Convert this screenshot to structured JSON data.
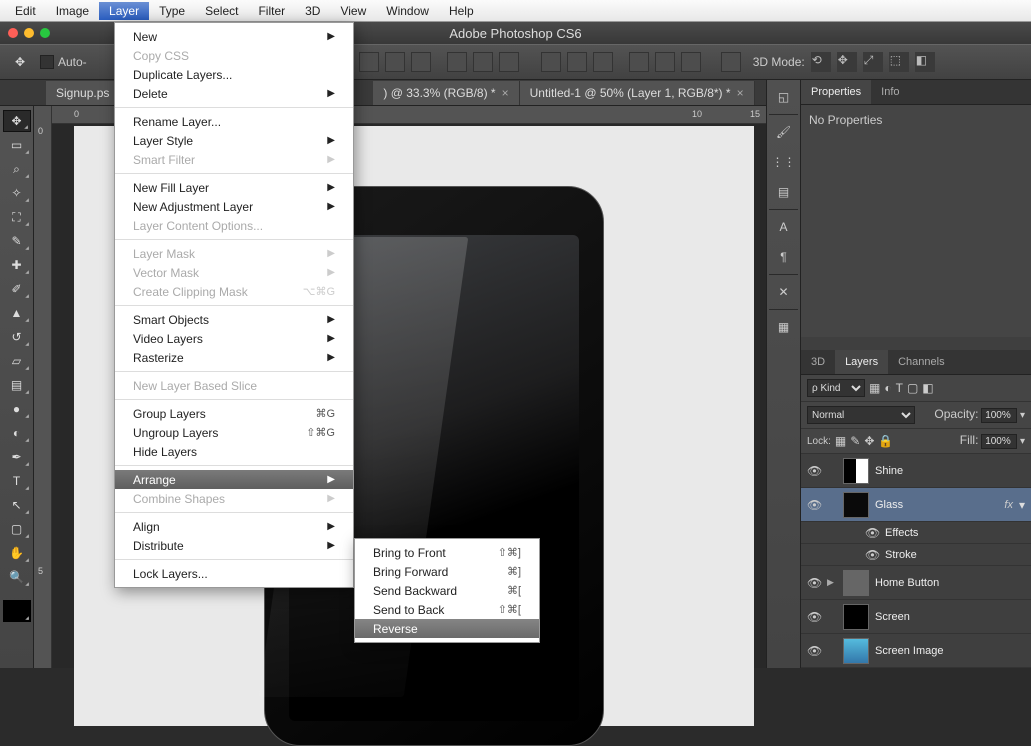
{
  "menubar": [
    "Edit",
    "Image",
    "Layer",
    "Type",
    "Select",
    "Filter",
    "3D",
    "View",
    "Window",
    "Help"
  ],
  "activeMenu": "Layer",
  "windowTitle": "Adobe Photoshop CS6",
  "optbar": {
    "auto": "Auto-",
    "mode3d": "3D Mode:"
  },
  "docTabs": [
    {
      "label": "Signup.ps",
      "close": "×"
    },
    {
      "label": ") @ 33.3% (RGB/8) *",
      "close": "×"
    },
    {
      "label": "Untitled-1 @ 50% (Layer 1, RGB/8*) *",
      "close": "×"
    }
  ],
  "rulerH": [
    "0",
    "10",
    "15"
  ],
  "rulerV": [
    "0",
    "5"
  ],
  "layerMenu": [
    {
      "t": "New",
      "arrow": true
    },
    {
      "t": "Copy CSS",
      "disabled": true
    },
    {
      "t": "Duplicate Layers..."
    },
    {
      "t": "Delete",
      "arrow": true
    },
    {
      "sep": true
    },
    {
      "t": "Rename Layer..."
    },
    {
      "t": "Layer Style",
      "arrow": true
    },
    {
      "t": "Smart Filter",
      "arrow": true,
      "disabled": true
    },
    {
      "sep": true
    },
    {
      "t": "New Fill Layer",
      "arrow": true
    },
    {
      "t": "New Adjustment Layer",
      "arrow": true
    },
    {
      "t": "Layer Content Options...",
      "disabled": true
    },
    {
      "sep": true
    },
    {
      "t": "Layer Mask",
      "arrow": true,
      "disabled": true
    },
    {
      "t": "Vector Mask",
      "arrow": true,
      "disabled": true
    },
    {
      "t": "Create Clipping Mask",
      "sc": "⌥⌘G",
      "disabled": true
    },
    {
      "sep": true
    },
    {
      "t": "Smart Objects",
      "arrow": true
    },
    {
      "t": "Video Layers",
      "arrow": true
    },
    {
      "t": "Rasterize",
      "arrow": true
    },
    {
      "sep": true
    },
    {
      "t": "New Layer Based Slice",
      "disabled": true
    },
    {
      "sep": true
    },
    {
      "t": "Group Layers",
      "sc": "⌘G"
    },
    {
      "t": "Ungroup Layers",
      "sc": "⇧⌘G"
    },
    {
      "t": "Hide Layers"
    },
    {
      "sep": true
    },
    {
      "t": "Arrange",
      "arrow": true,
      "hover": true
    },
    {
      "t": "Combine Shapes",
      "arrow": true,
      "disabled": true
    },
    {
      "sep": true
    },
    {
      "t": "Align",
      "arrow": true
    },
    {
      "t": "Distribute",
      "arrow": true
    },
    {
      "sep": true
    },
    {
      "t": "Lock Layers..."
    }
  ],
  "arrangeSub": [
    {
      "t": "Bring to Front",
      "sc": "⇧⌘]"
    },
    {
      "t": "Bring Forward",
      "sc": "⌘]"
    },
    {
      "t": "Send Backward",
      "sc": "⌘["
    },
    {
      "t": "Send to Back",
      "sc": "⇧⌘["
    },
    {
      "t": "Reverse",
      "hover": true
    }
  ],
  "propsPanel": {
    "tab1": "Properties",
    "tab2": "Info",
    "body": "No Properties"
  },
  "layersPanel": {
    "tab0": "3D",
    "tab1": "Layers",
    "tab2": "Channels",
    "kind": "ρ Kind",
    "mode": "Normal",
    "opacityLabel": "Opacity:",
    "opacity": "100%",
    "lockLabel": "Lock:",
    "fillLabel": "Fill:",
    "fill": "100%"
  },
  "layers": [
    {
      "name": "Shine",
      "thumb": "shine"
    },
    {
      "name": "Glass",
      "thumb": "glass",
      "sel": true,
      "fx": "fx"
    },
    {
      "name": "Effects",
      "sub": true
    },
    {
      "name": "Stroke",
      "sub": true
    },
    {
      "name": "Home Button",
      "thumb": "folder",
      "tri": true
    },
    {
      "name": "Screen",
      "thumb": "screen"
    },
    {
      "name": "Screen Image",
      "thumb": "simg"
    }
  ]
}
